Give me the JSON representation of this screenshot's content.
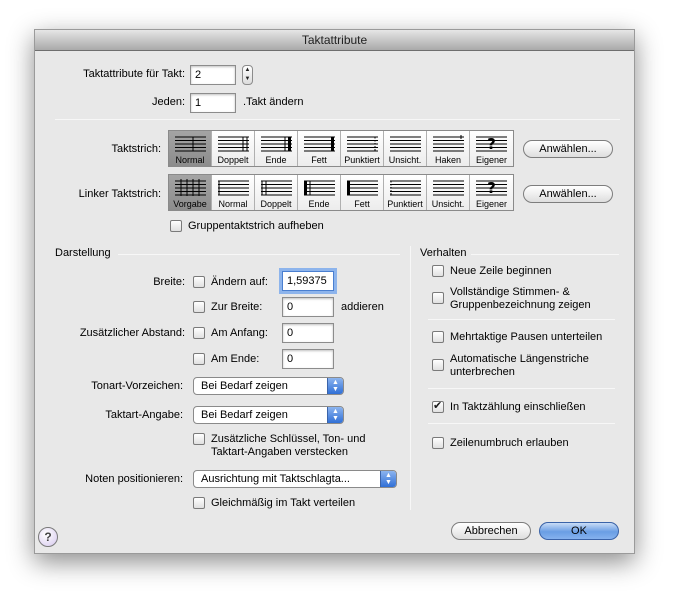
{
  "dialog": {
    "title": "Taktattribute"
  },
  "top": {
    "takt_label": "Taktattribute für Takt:",
    "takt_value": "2",
    "jeden_label": "Jeden:",
    "jeden_value": "1",
    "jeden_suffix": ".Takt ändern"
  },
  "taktstrich": {
    "label": "Taktstrich:",
    "items": [
      "Normal",
      "Doppelt",
      "Ende",
      "Fett",
      "Punktiert",
      "Unsicht.",
      "Haken",
      "Eigener"
    ],
    "selected": "Normal",
    "select_button": "Anwählen..."
  },
  "linker_taktstrich": {
    "label": "Linker Taktstrich:",
    "items": [
      "Vorgabe",
      "Normal",
      "Doppelt",
      "Ende",
      "Fett",
      "Punktiert",
      "Unsicht.",
      "Eigener"
    ],
    "selected": "Vorgabe",
    "select_button": "Anwählen..."
  },
  "gruppen_checkbox": {
    "label": "Gruppentaktstrich aufheben",
    "checked": false
  },
  "darstellung": {
    "title": "Darstellung",
    "breite_label": "Breite:",
    "aendern_auf_label": "Ändern auf:",
    "aendern_auf_checked": false,
    "aendern_auf_value": "1,59375",
    "zur_breite_label": "Zur Breite:",
    "zur_breite_checked": false,
    "zur_breite_value": "0",
    "addieren_label": "addieren",
    "abstand_label": "Zusätzlicher Abstand:",
    "am_anfang_label": "Am Anfang:",
    "am_anfang_checked": false,
    "am_anfang_value": "0",
    "am_ende_label": "Am Ende:",
    "am_ende_checked": false,
    "am_ende_value": "0",
    "tonart_label": "Tonart-Vorzeichen:",
    "tonart_value": "Bei Bedarf zeigen",
    "taktart_label": "Taktart-Angabe:",
    "taktart_value": "Bei Bedarf zeigen",
    "verstecken_label_1": "Zusätzliche Schlüssel, Ton- und",
    "verstecken_label_2": "Taktart-Angaben verstecken",
    "verstecken_checked": false,
    "noten_label": "Noten positionieren:",
    "noten_value": "Ausrichtung mit Taktschlagta...",
    "gleichmaessig_label": "Gleichmäßig im Takt verteilen",
    "gleichmaessig_checked": false
  },
  "verhalten": {
    "title": "Verhalten",
    "neue_zeile": "Neue Zeile beginnen",
    "vollstaendige_1": "Vollständige Stimmen- &",
    "vollstaendige_2": "Gruppenbezeichnung zeigen",
    "mehrtaktige": "Mehrtaktige Pausen unterteilen",
    "automatische_1": "Automatische Längenstriche",
    "automatische_2": "unterbrechen",
    "in_taktzaehlung": "In Taktzählung einschließen",
    "in_taktzaehlung_checked": true,
    "zeilenumbruch": "Zeilenumbruch erlauben"
  },
  "footer": {
    "cancel": "Abbrechen",
    "ok": "OK",
    "help": "?"
  }
}
